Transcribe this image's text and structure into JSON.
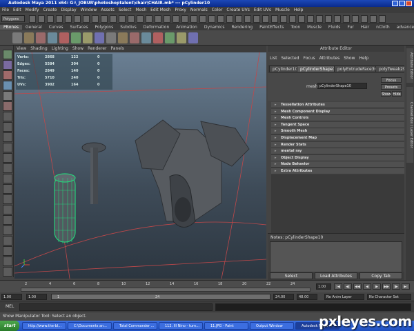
{
  "window": {
    "title": "Autodesk Maya 2011 x64: G:\\_JOBUR\\photoshoptalent\\chair\\CHAIR.mb* --- pCylinder10"
  },
  "menubar": [
    "File",
    "Edit",
    "Modify",
    "Create",
    "Display",
    "Window",
    "Assets",
    "Select",
    "Mesh",
    "Edit Mesh",
    "Proxy",
    "Normals",
    "Color",
    "Create UVs",
    "Edit UVs",
    "Muscle",
    "Help"
  ],
  "statusline": {
    "mode": "Polygons"
  },
  "shelf": {
    "tabs": [
      "PBones",
      "General",
      "Curves",
      "Surfaces",
      "Polygons",
      "Subdivs",
      "Deformation",
      "Animation",
      "Dynamics",
      "Rendering",
      "PaintEffects",
      "Toon",
      "Muscle",
      "Fluids",
      "Fur",
      "Hair",
      "nCloth",
      "advancedSkeleton"
    ],
    "active_tab": "PBones"
  },
  "viewport": {
    "menu": [
      "View",
      "Shading",
      "Lighting",
      "Show",
      "Renderer",
      "Panels"
    ],
    "hud": [
      {
        "label": "Verts:",
        "total": "2868",
        "sel": "122",
        "comp": "0"
      },
      {
        "label": "Edges:",
        "total": "5584",
        "sel": "304",
        "comp": "0"
      },
      {
        "label": "Faces:",
        "total": "2849",
        "sel": "140",
        "comp": "0"
      },
      {
        "label": "Tris:",
        "total": "5710",
        "sel": "240",
        "comp": "0"
      },
      {
        "label": "UVs:",
        "total": "3902",
        "sel": "164",
        "comp": "0"
      }
    ]
  },
  "attribute_editor": {
    "title": "Attribute Editor",
    "menu": [
      "List",
      "Selected",
      "Focus",
      "Attributes",
      "Show",
      "Help"
    ],
    "tabs": [
      "pCylinder10",
      "pCylinderShape10",
      "polyExtrudeFace36",
      "polyTweak29"
    ],
    "active_tab": "pCylinderShape10",
    "mesh_label": "mesh:",
    "mesh_value": "pCylinderShape10",
    "side_buttons": [
      "Focus",
      "Presets",
      "Show",
      "Hide"
    ],
    "sections": [
      "Tessellation Attributes",
      "Mesh Component Display",
      "Mesh Controls",
      "Tangent Space",
      "Smooth Mesh",
      "Displacement Map",
      "Render Stats",
      "mental ray",
      "Object Display",
      "Node Behavior",
      "Extra Attributes"
    ],
    "notes_label": "Notes: pCylinderShape10",
    "buttons": [
      "Select",
      "Load Attributes",
      "Copy Tab"
    ]
  },
  "side_tabs": [
    "Attribute Editor",
    "Channel Box / Layer Editor"
  ],
  "time_slider": {
    "ticks": [
      "2",
      "4",
      "6",
      "8",
      "10",
      "12",
      "14",
      "16",
      "18",
      "20",
      "22",
      "24"
    ],
    "current": "1.00"
  },
  "range_slider": {
    "start": "1.00",
    "start2": "1.00",
    "range_start": "1",
    "range_end": "24",
    "end": "24.00",
    "end2": "48.00",
    "anim_layer": "No Anim Layer",
    "char_set": "No Character Set"
  },
  "command_line": {
    "label": "MEL"
  },
  "help_line": {
    "text": "Show Manipulator Tool: Select an object."
  },
  "taskbar": {
    "start": "start",
    "items": [
      "http://www.the-bl...",
      "C:\\Documents an...",
      "Total Commander ...",
      "112. Ill Nino - turn...",
      "11.JPG - Paint",
      "Output Window",
      "Autodesk Maya ..."
    ],
    "active_index": 6
  },
  "watermark": "pxleyes.com",
  "colors": {
    "selection_wire": "#27d07a",
    "grid": "#c0484a",
    "accent": "#5e5e5e"
  }
}
